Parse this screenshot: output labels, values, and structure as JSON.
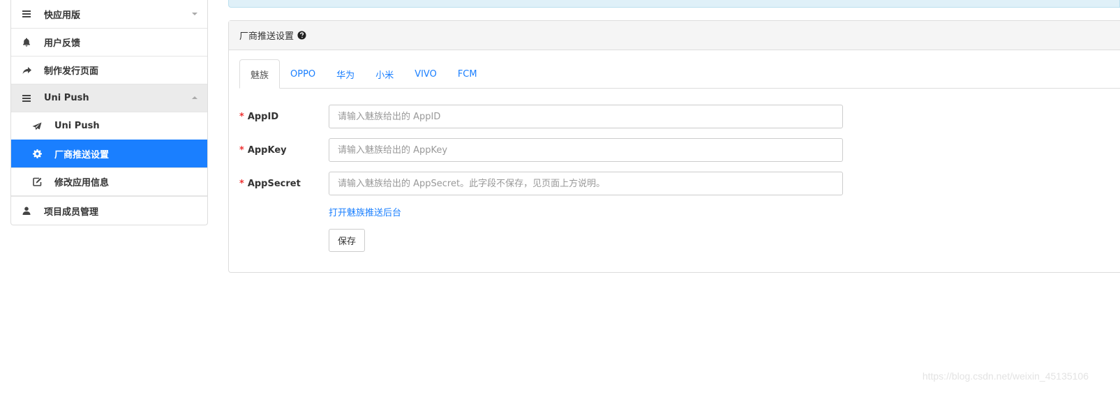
{
  "sidebar": {
    "items": [
      {
        "label": "快应用版",
        "icon": "list-icon",
        "caret": "down"
      },
      {
        "label": "用户反馈",
        "icon": "bell-icon"
      },
      {
        "label": "制作发行页面",
        "icon": "share-icon"
      },
      {
        "label": "Uni Push",
        "icon": "list-icon",
        "caret": "up"
      },
      {
        "label": "Uni Push",
        "icon": "paper-plane-icon"
      },
      {
        "label": "厂商推送设置",
        "icon": "gear-icon"
      },
      {
        "label": "修改应用信息",
        "icon": "edit-icon"
      },
      {
        "label": "项目成员管理",
        "icon": "user-icon"
      }
    ]
  },
  "panel": {
    "title": "厂商推送设置",
    "help_icon": "question-circle-icon"
  },
  "tabs": [
    {
      "label": "魅族",
      "active": true
    },
    {
      "label": "OPPO"
    },
    {
      "label": "华为"
    },
    {
      "label": "小米"
    },
    {
      "label": "VIVO"
    },
    {
      "label": "FCM"
    }
  ],
  "form": {
    "required_mark": "*",
    "appid": {
      "label": "AppID",
      "value": "",
      "placeholder": "请输入魅族给出的 AppID"
    },
    "appkey": {
      "label": "AppKey",
      "value": "",
      "placeholder": "请输入魅族给出的 AppKey"
    },
    "appsecret": {
      "label": "AppSecret",
      "value": "",
      "placeholder": "请输入魅族给出的 AppSecret。此字段不保存，见页面上方说明。"
    },
    "link_text": "打开魅族推送后台",
    "save_label": "保存"
  },
  "watermark": "https://blog.csdn.net/weixin_45135106",
  "colors": {
    "accent": "#1a7fff",
    "required": "#e33333",
    "info_bg": "#dff0f8"
  }
}
